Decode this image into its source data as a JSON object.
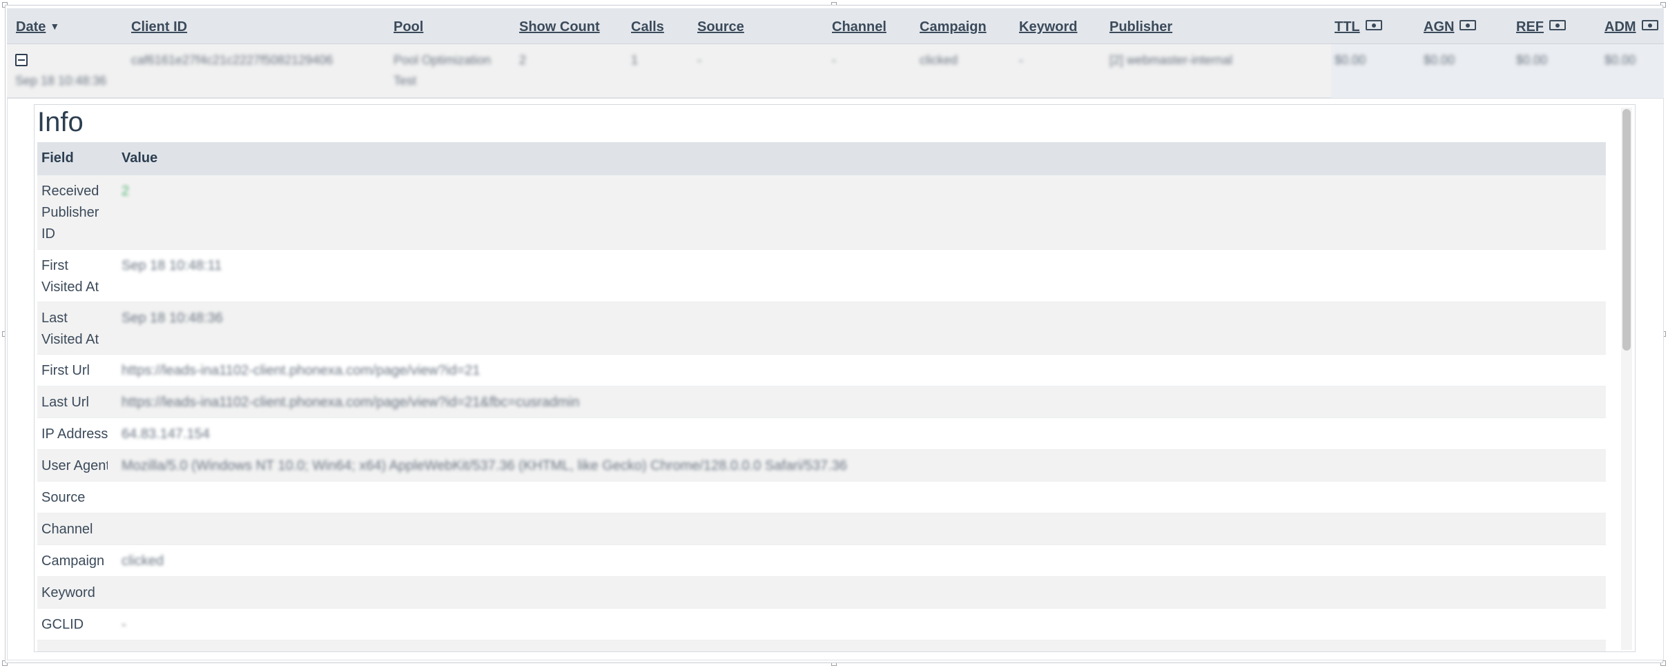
{
  "table": {
    "columns": [
      {
        "label": "Date",
        "sort": true
      },
      {
        "label": "Client ID"
      },
      {
        "label": "Pool"
      },
      {
        "label": "Show Count"
      },
      {
        "label": "Calls"
      },
      {
        "label": "Source"
      },
      {
        "label": "Channel"
      },
      {
        "label": "Campaign"
      },
      {
        "label": "Keyword"
      },
      {
        "label": "Publisher"
      },
      {
        "label": "TTL",
        "money": true
      },
      {
        "label": "AGN",
        "money": true
      },
      {
        "label": "REF",
        "money": true
      },
      {
        "label": "ADM",
        "money": true
      }
    ],
    "row": {
      "date": "Sep 18 10:48:36",
      "client_id": "caf6161e27f4c21c2227f5082129406",
      "pool_line1": "Pool Optimization",
      "pool_line2": "Test",
      "show_count": "2",
      "calls": "1",
      "source": "-",
      "channel": "-",
      "campaign": "clicked",
      "keyword": "-",
      "publisher": "[2] webmaster-internal",
      "ttl": "$0.00",
      "agn": "$0.00",
      "ref": "$0.00",
      "adm": "$0.00"
    }
  },
  "info": {
    "title": "Info",
    "field_header": "Field",
    "value_header": "Value",
    "rows": [
      {
        "field": "Received Publisher ID",
        "value": "2"
      },
      {
        "field": "First Visited At",
        "value": "Sep 18 10:48:11"
      },
      {
        "field": "Last Visited At",
        "value": "Sep 18 10:48:36"
      },
      {
        "field": "First Url",
        "value": "https://leads-ina1102-client.phonexa.com/page/view?id=21"
      },
      {
        "field": "Last Url",
        "value": "https://leads-ina1102-client.phonexa.com/page/view?id=21&fbc=cusradmin"
      },
      {
        "field": "IP Address",
        "value": "64.83.147.154"
      },
      {
        "field": "User Agent",
        "value": "Mozilla/5.0 (Windows NT 10.0; Win64; x64) AppleWebKit/537.36 (KHTML, like Gecko) Chrome/128.0.0.0 Safari/537.36"
      },
      {
        "field": "Source",
        "value": ""
      },
      {
        "field": "Channel",
        "value": ""
      },
      {
        "field": "Campaign",
        "value": "clicked"
      },
      {
        "field": "Keyword",
        "value": ""
      },
      {
        "field": "GCLID",
        "value": "-"
      }
    ]
  },
  "icons": {
    "collapse": "minus-square-icon",
    "money": "money-icon",
    "sort": "caret-down-icon"
  },
  "colors": {
    "header_bg": "#e3e7ec",
    "row_bg": "#f1f1f1",
    "accent_green": "#4cb36c",
    "text_dark": "#2c3e50"
  }
}
